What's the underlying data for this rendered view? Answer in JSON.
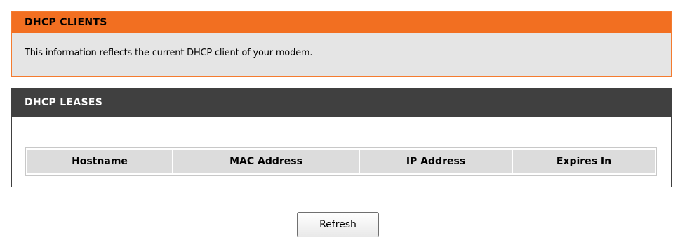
{
  "dhcp_clients": {
    "title": "DHCP CLIENTS",
    "description": "This information reflects the current DHCP client of your modem."
  },
  "dhcp_leases": {
    "title": "DHCP LEASES",
    "columns": [
      "Hostname",
      "MAC Address",
      "IP Address",
      "Expires In"
    ],
    "rows": []
  },
  "actions": {
    "refresh_label": "Refresh"
  },
  "colors": {
    "clients_header": "#f26f21",
    "leases_header": "#404040",
    "panel_bg": "#e5e5e5",
    "table_header_bg": "#dcdcdc"
  }
}
